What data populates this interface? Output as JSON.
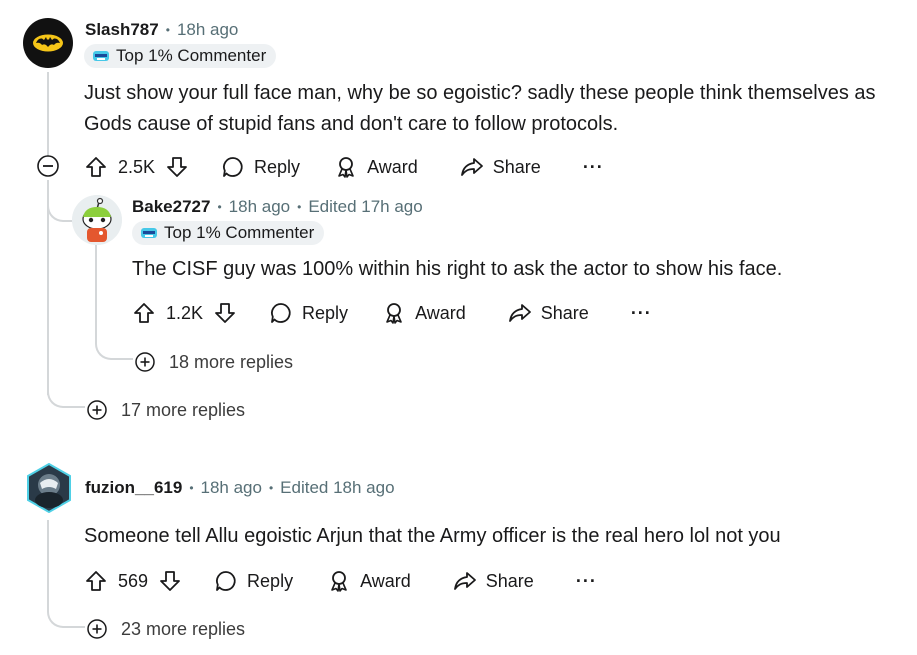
{
  "comments": [
    {
      "user": "Slash787",
      "time": "18h ago",
      "badge": "Top 1% Commenter",
      "text_lines": [
        "Just show your full face man, why be so egoistic? sadly these people think themselves as",
        "Gods cause of stupid fans and don't care to follow protocols."
      ],
      "votes": "2.5K",
      "more_replies": "17 more replies"
    },
    {
      "user": "Bake2727",
      "time": "18h ago",
      "edited": "Edited 17h ago",
      "badge": "Top 1% Commenter",
      "text": "The CISF guy was 100% within his right to ask the actor to show his face.",
      "votes": "1.2K",
      "more_replies": "18 more replies"
    },
    {
      "user": "fuzion__619",
      "time": "18h ago",
      "edited": "Edited 18h ago",
      "text": "Someone tell Allu egoistic Arjun that the Army officer is the real hero lol not you",
      "votes": "569",
      "more_replies": "23 more replies"
    }
  ],
  "labels": {
    "reply": "Reply",
    "award": "Award",
    "share": "Share",
    "more": "···",
    "dot": "•"
  },
  "colors": {
    "thread_line": "#d4d7d9",
    "meta_gray": "#576f76",
    "badge_bg": "#eef1f3",
    "text": "#1a1a1b"
  }
}
